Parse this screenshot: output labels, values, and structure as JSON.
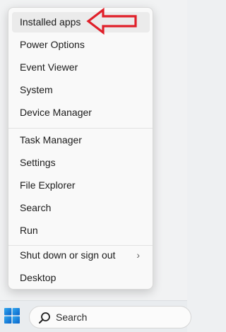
{
  "menu": {
    "group1": [
      {
        "label": "Installed apps"
      },
      {
        "label": "Power Options"
      },
      {
        "label": "Event Viewer"
      },
      {
        "label": "System"
      },
      {
        "label": "Device Manager"
      }
    ],
    "group2": [
      {
        "label": "Task Manager"
      },
      {
        "label": "Settings"
      },
      {
        "label": "File Explorer"
      },
      {
        "label": "Search"
      },
      {
        "label": "Run"
      }
    ],
    "group3": [
      {
        "label": "Shut down or sign out",
        "chevron": "›"
      },
      {
        "label": "Desktop"
      }
    ]
  },
  "annotation": {
    "icon": "red-outline-arrow-icon",
    "color": "#e0202a"
  },
  "taskbar": {
    "start_icon": "windows-logo-icon",
    "search_icon": "search-icon",
    "search_label": "Search"
  },
  "colors": {
    "menu_bg": "#f9f9f9",
    "highlight": "#ebebeb",
    "accent_blue": "#0078d4",
    "arrow_red": "#e0202a"
  }
}
